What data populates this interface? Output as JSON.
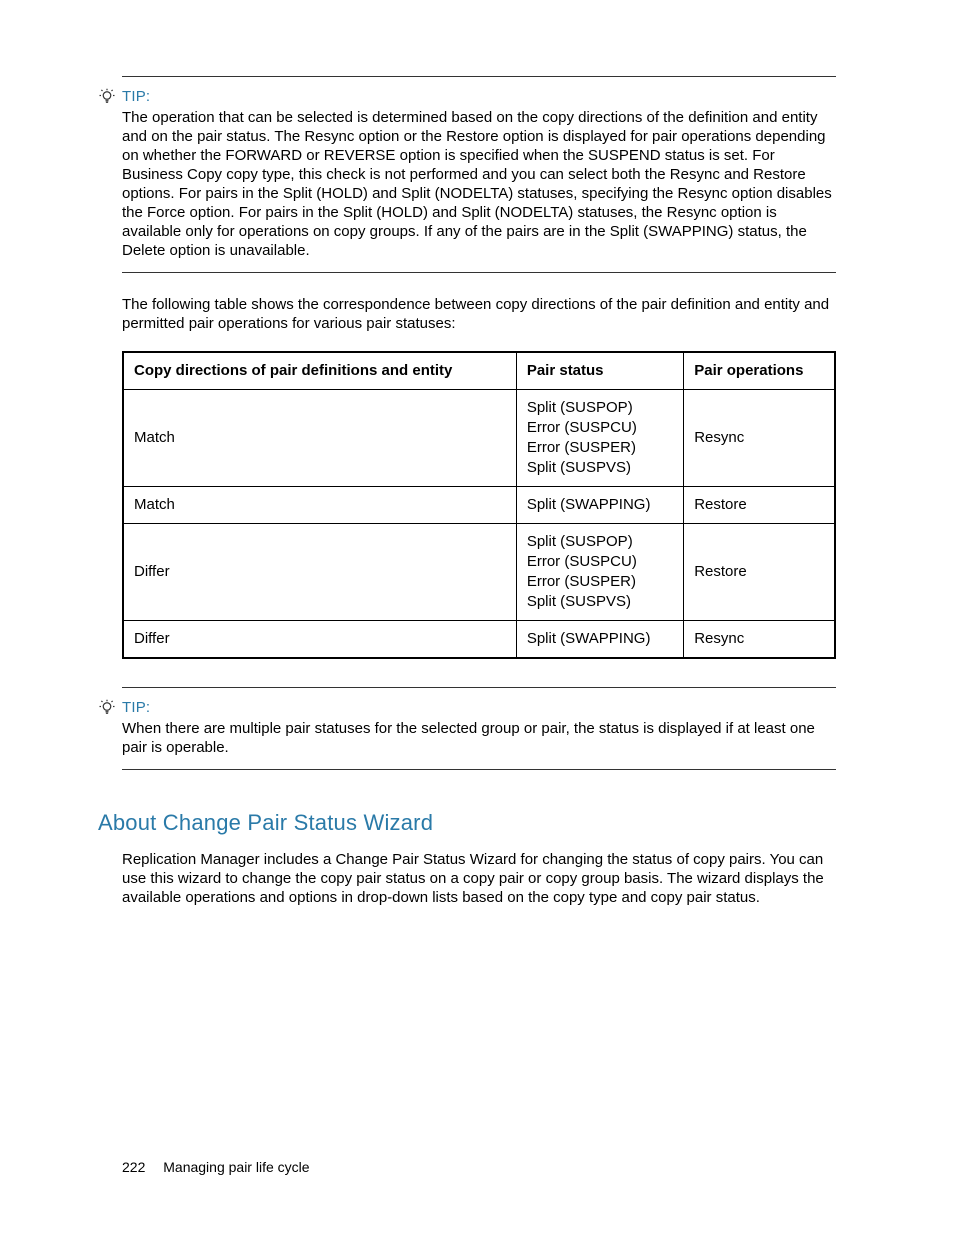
{
  "tip1": {
    "label": "TIP:",
    "text": "The operation that can be selected is determined based on the copy directions of the definition and entity and on the pair status. The Resync option or the Restore option is displayed for pair operations depending on whether the FORWARD or REVERSE option is specified when the SUSPEND status is set. For Business Copy copy type, this check is not performed and you can select both the Resync and Restore options. For pairs in the Split (HOLD) and Split (NODELTA) statuses, specifying the Resync option disables the Force option. For pairs in the Split (HOLD) and Split (NODELTA) statuses, the Resync option is available only for operations on copy groups. If any of the pairs are in the Split (SWAPPING) status, the Delete option is unavailable."
  },
  "intro": "The following table shows the correspondence between copy directions of the pair definition and entity and permitted pair operations for various pair statuses:",
  "table": {
    "headers": {
      "col1": "Copy directions of pair definitions and entity",
      "col2": "Pair status",
      "col3": "Pair operations"
    },
    "rows": [
      {
        "col1": "Match",
        "col2": [
          "Split (SUSPOP)",
          "Error (SUSPCU)",
          "Error (SUSPER)",
          "Split (SUSPVS)"
        ],
        "col3": "Resync"
      },
      {
        "col1": "Match",
        "col2": [
          "Split (SWAPPING)"
        ],
        "col3": "Restore"
      },
      {
        "col1": "Differ",
        "col2": [
          "Split (SUSPOP)",
          "Error (SUSPCU)",
          "Error (SUSPER)",
          "Split (SUSPVS)"
        ],
        "col3": "Restore"
      },
      {
        "col1": "Differ",
        "col2": [
          "Split (SWAPPING)"
        ],
        "col3": "Resync"
      }
    ]
  },
  "tip2": {
    "label": "TIP:",
    "text": "When there are multiple pair statuses for the selected group or pair, the status is displayed if at least one pair is operable."
  },
  "section": {
    "heading": "About Change Pair Status Wizard",
    "text": "Replication Manager includes a Change Pair Status Wizard for changing the status of copy pairs. You can use this wizard to change the copy pair status on a copy pair or copy group basis. The wizard displays the available operations and options in drop-down lists based on the copy type and copy pair status."
  },
  "footer": {
    "page": "222",
    "title": "Managing pair life cycle"
  }
}
